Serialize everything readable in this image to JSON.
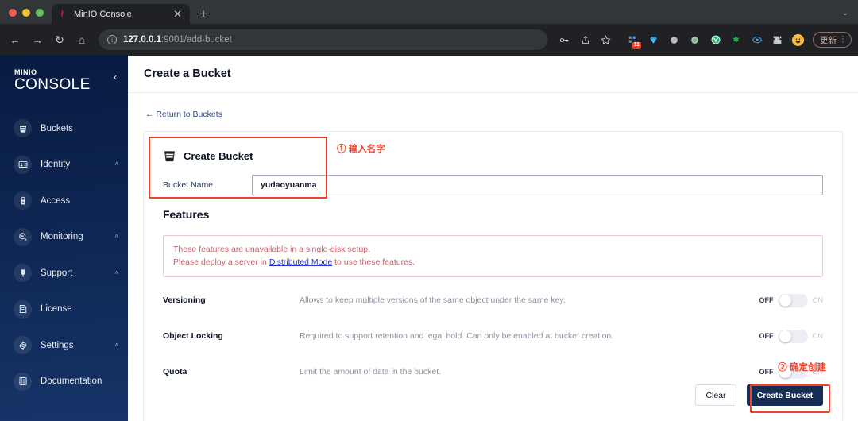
{
  "browser": {
    "tab": {
      "title": "MinIO Console",
      "favicon": "minio-favicon",
      "close": "✕"
    },
    "newtab_label": "+",
    "window_chevron": "⌄",
    "nav": {
      "back": "←",
      "forward": "→",
      "reload": "↻",
      "home": "⌂"
    },
    "omnibox": {
      "info_icon": "i",
      "url_host": "127.0.0.1",
      "url_rest": ":9001/add-bucket"
    },
    "toolbar_icons": [
      {
        "name": "key-icon",
        "glyph": "⚷"
      },
      {
        "name": "share-icon",
        "glyph": "⇧"
      },
      {
        "name": "bookmark-star-icon",
        "glyph": "☆"
      }
    ],
    "extensions": [
      {
        "name": "tasks-extension",
        "badge": "11"
      },
      {
        "name": "diamond-extension"
      },
      {
        "name": "gray-globe-extension"
      },
      {
        "name": "green-dot-extension"
      },
      {
        "name": "youdao-extension"
      },
      {
        "name": "green-puzzle-extension"
      },
      {
        "name": "eye-extension"
      },
      {
        "name": "puzzle-extensions-icon"
      }
    ],
    "profile_avatar": "😀",
    "update_button": "更新",
    "menu_kebab": "⋮"
  },
  "sidebar": {
    "brand_top": "MINIO",
    "brand_bottom": "CONSOLE",
    "collapse_icon": "‹",
    "items": [
      {
        "label": "Buckets",
        "icon": "buckets-icon",
        "expandable": false
      },
      {
        "label": "Identity",
        "icon": "identity-icon",
        "expandable": true,
        "caret": "˄"
      },
      {
        "label": "Access",
        "icon": "access-icon",
        "expandable": false
      },
      {
        "label": "Monitoring",
        "icon": "monitoring-icon",
        "expandable": true,
        "caret": "˄"
      },
      {
        "label": "Support",
        "icon": "support-icon",
        "expandable": true,
        "caret": "˄"
      },
      {
        "label": "License",
        "icon": "license-icon",
        "expandable": false
      },
      {
        "label": "Settings",
        "icon": "settings-icon",
        "expandable": true,
        "caret": "˄"
      },
      {
        "label": "Documentation",
        "icon": "documentation-icon",
        "expandable": false
      }
    ]
  },
  "page": {
    "title": "Create a Bucket",
    "return_link": "← Return to Buckets"
  },
  "form": {
    "card_title": "Create Bucket",
    "bucket_name_label": "Bucket Name",
    "bucket_name_value": "yudaoyuanma",
    "bucket_name_placeholder": "",
    "features_heading": "Features",
    "warning_line1": "These features are unavailable in a single-disk setup.",
    "warning_line2_pre": "Please deploy a server in ",
    "warning_link": "Distributed Mode",
    "warning_line2_post": " to use these features.",
    "toggle_off_label": "OFF",
    "toggle_on_label": "ON",
    "features": [
      {
        "name": "Versioning",
        "description": "Allows to keep multiple versions of the same object under the same key.",
        "state": "OFF"
      },
      {
        "name": "Object Locking",
        "description": "Required to support retention and legal hold. Can only be enabled at bucket creation.",
        "state": "OFF"
      },
      {
        "name": "Quota",
        "description": "Limit the amount of data in the bucket.",
        "state": "OFF"
      }
    ],
    "clear_button": "Clear",
    "create_button": "Create Bucket"
  },
  "annotations": [
    {
      "text": "① 输入名字",
      "color": "#f3402a"
    },
    {
      "text": "② 确定创建",
      "color": "#f3402a"
    }
  ]
}
